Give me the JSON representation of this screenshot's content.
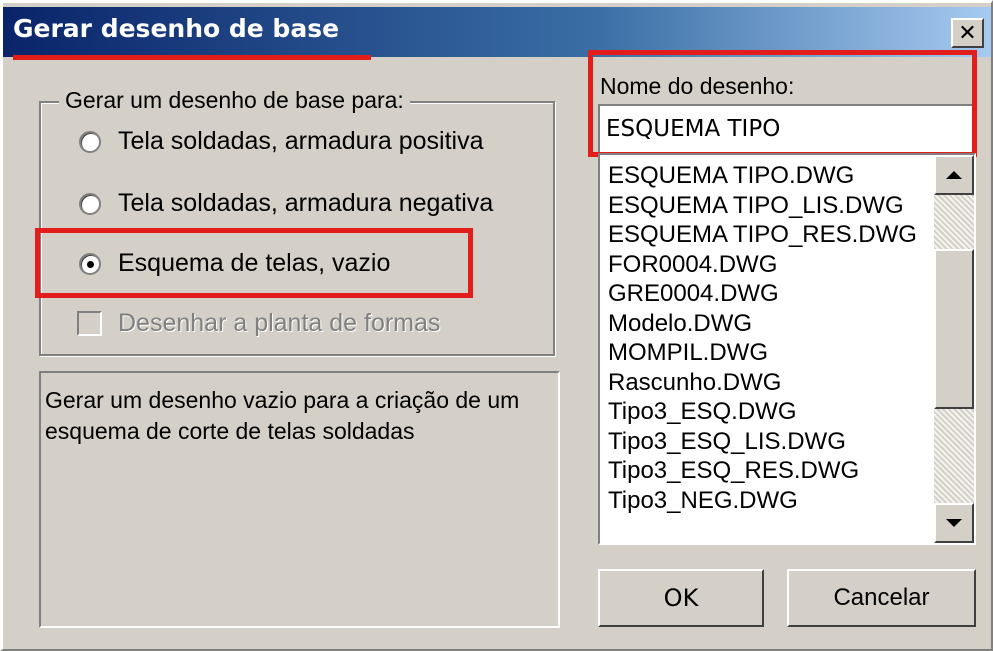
{
  "window": {
    "title": "Gerar desenho de base",
    "close_glyph": "✕"
  },
  "group": {
    "legend": "Gerar um desenho de base para:",
    "options": [
      {
        "label": "Tela soldadas, armadura positiva",
        "selected": false
      },
      {
        "label": "Tela soldadas, armadura negativa",
        "selected": false
      },
      {
        "label": "Esquema de telas, vazio",
        "selected": true
      }
    ],
    "checkbox": {
      "label": "Desenhar a planta de formas",
      "checked": false,
      "enabled": false
    }
  },
  "description": "Gerar um desenho vazio para a criação de um esquema de corte de telas soldadas",
  "drawing_name": {
    "label": "Nome do desenho:",
    "value": "ESQUEMA TIPO"
  },
  "file_list": [
    "ESQUEMA TIPO.DWG",
    "ESQUEMA TIPO_LIS.DWG",
    "ESQUEMA TIPO_RES.DWG",
    "FOR0004.DWG",
    "GRE0004.DWG",
    "Modelo.DWG",
    "MOMPIL.DWG",
    "Rascunho.DWG",
    "Tipo3_ESQ.DWG",
    "Tipo3_ESQ_LIS.DWG",
    "Tipo3_ESQ_RES.DWG",
    "Tipo3_NEG.DWG"
  ],
  "buttons": {
    "ok": "OK",
    "cancel": "Cancelar"
  },
  "colors": {
    "annotation_red": "#e31c1c",
    "titlebar_start": "#0a246a",
    "titlebar_end": "#a6caf0",
    "face": "#d4d0c8"
  }
}
